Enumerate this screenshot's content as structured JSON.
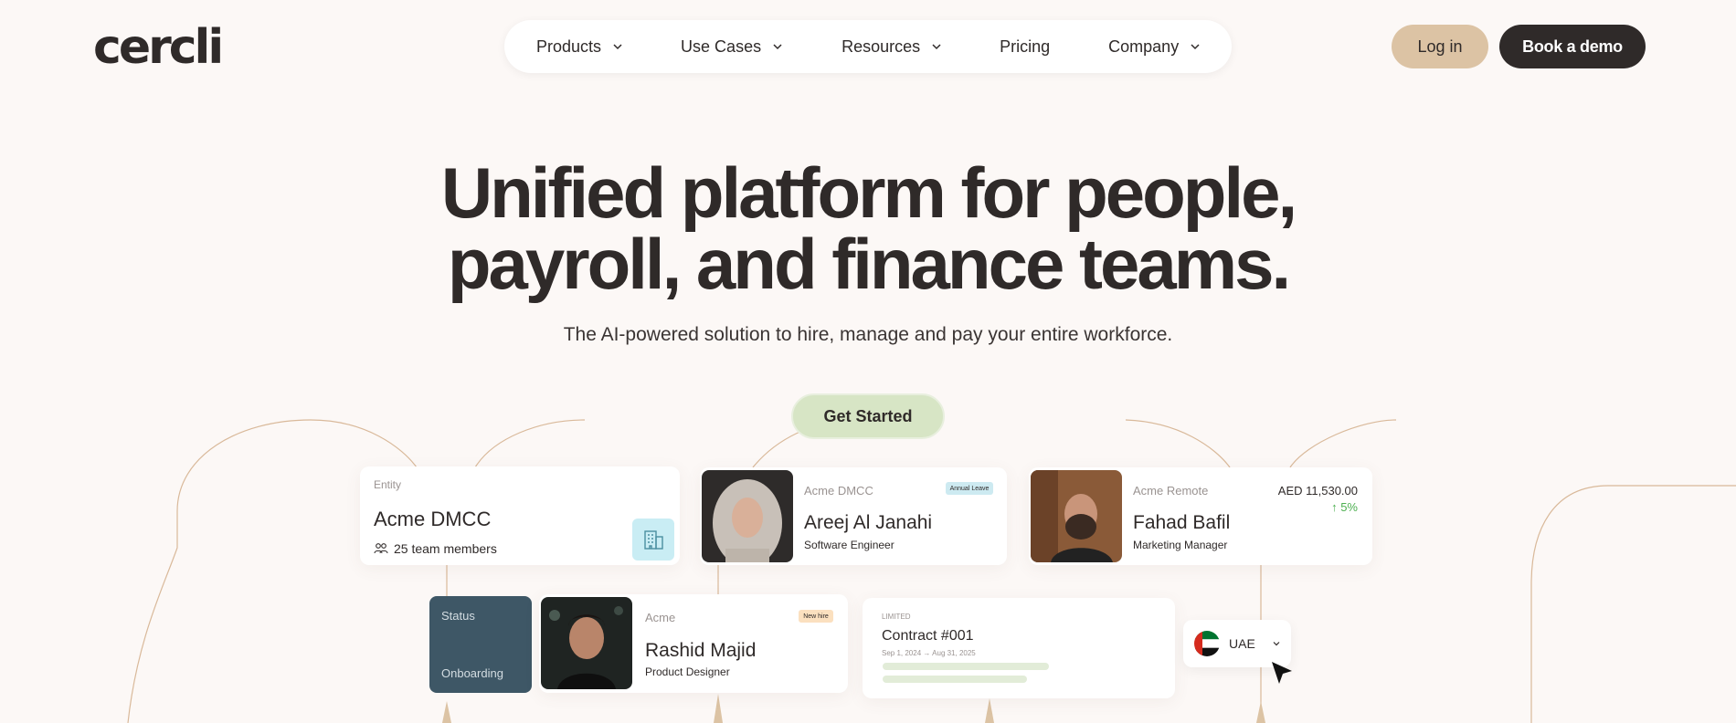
{
  "header": {
    "logo": "cercli",
    "nav": [
      {
        "label": "Products",
        "has_dropdown": true
      },
      {
        "label": "Use Cases",
        "has_dropdown": true
      },
      {
        "label": "Resources",
        "has_dropdown": true
      },
      {
        "label": "Pricing",
        "has_dropdown": false
      },
      {
        "label": "Company",
        "has_dropdown": true
      }
    ],
    "login_label": "Log in",
    "demo_label": "Book a demo"
  },
  "hero": {
    "title_line1": "Unified platform for people,",
    "title_line2": "payroll, and finance teams.",
    "subtitle": "The AI-powered solution to hire, manage and pay your entire workforce.",
    "cta_label": "Get Started"
  },
  "cards": {
    "entity": {
      "label": "Entity",
      "name": "Acme DMCC",
      "members": "25 team members",
      "icon": "building-icon"
    },
    "areej": {
      "company": "Acme DMCC",
      "name": "Areej Al Janahi",
      "role": "Software Engineer",
      "badge": "Annual Leave"
    },
    "fahad": {
      "company": "Acme Remote",
      "name": "Fahad Bafil",
      "role": "Marketing Manager",
      "amount": "AED 11,530.00",
      "change": "↑ 5%"
    },
    "status": {
      "label": "Status",
      "value": "Onboarding"
    },
    "rashid": {
      "company": "Acme",
      "name": "Rashid Majid",
      "role": "Product Designer",
      "badge": "New hire"
    },
    "contract": {
      "tag": "LIMITED",
      "title": "Contract #001",
      "dates": "Sep 1, 2024 → Aug 31, 2025"
    },
    "country": {
      "label": "UAE",
      "icon": "uae-flag-icon"
    }
  },
  "colors": {
    "background": "#fcf8f6",
    "text_dark": "#2f2a29",
    "login_bg": "#dcc3a4",
    "cta_bg": "#d7e5c5",
    "status_bg": "#3e5766",
    "line_color": "#d9b99a"
  }
}
